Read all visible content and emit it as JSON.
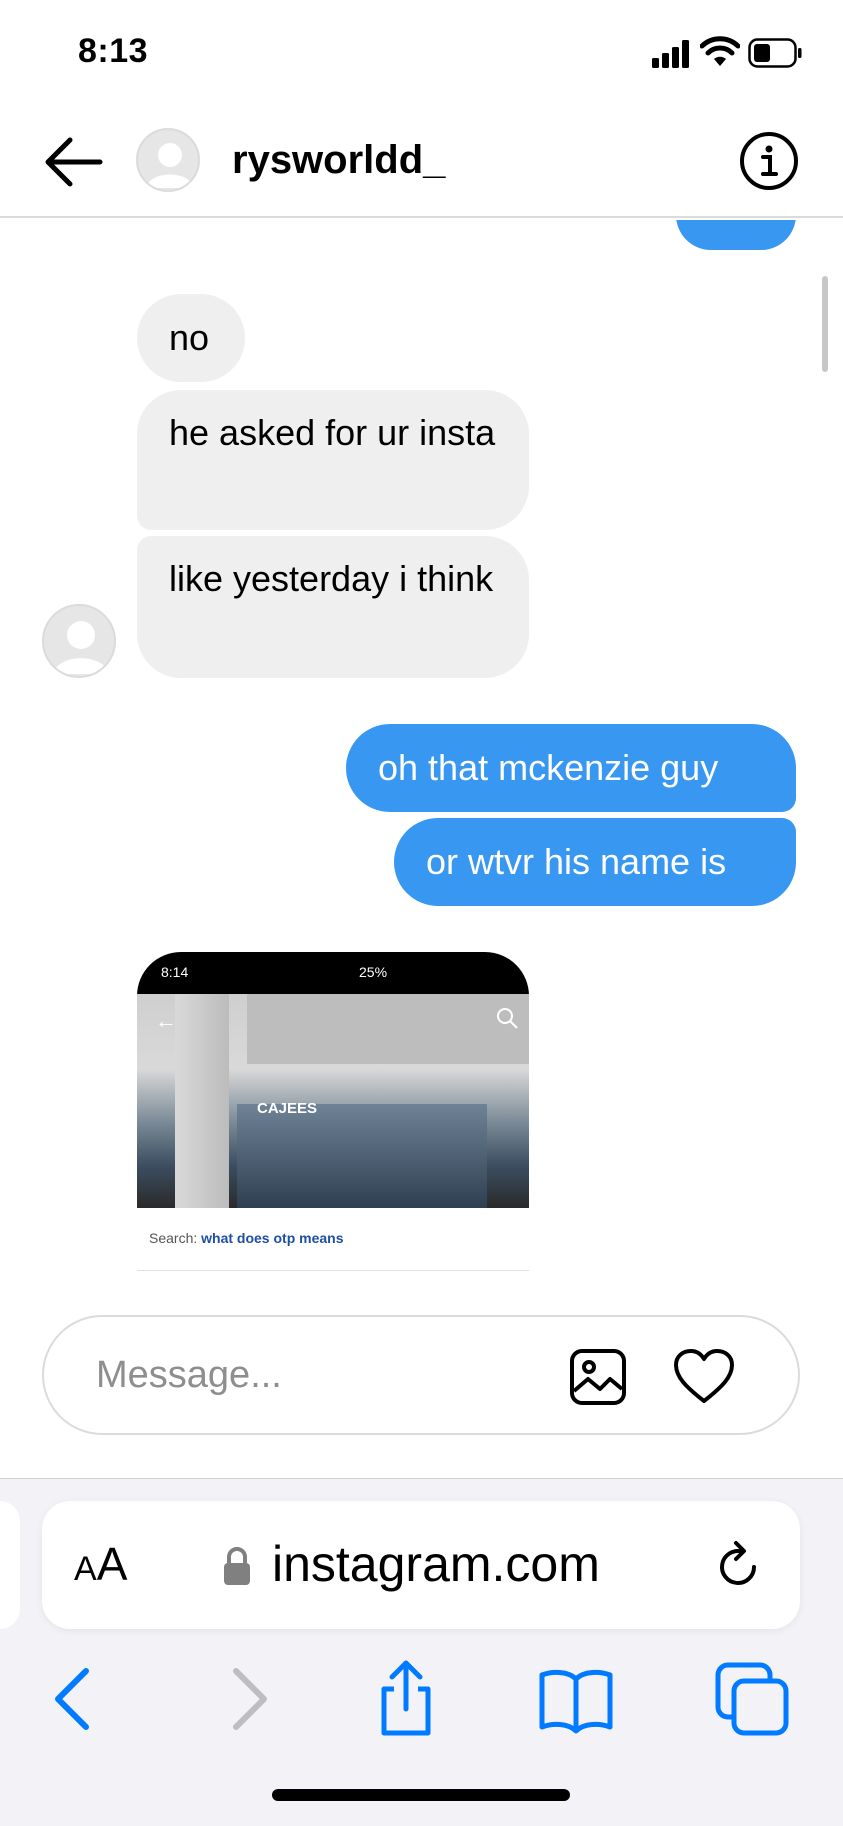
{
  "status_bar": {
    "time": "8:13"
  },
  "header": {
    "username": "rysworldd_"
  },
  "messages": {
    "incoming": [
      "no",
      "he asked for ur insta",
      "like yesterday i think"
    ],
    "outgoing": [
      "oh that mckenzie guy",
      "or wtvr his name is"
    ]
  },
  "shared_media": {
    "status_time": "8:14",
    "status_right": "25%",
    "store_sign": "CAJEES",
    "search_label": "Search:",
    "search_query": "what does otp means"
  },
  "composer": {
    "placeholder": "Message..."
  },
  "browser": {
    "aa_small": "A",
    "aa_large": "A",
    "url": "instagram.com"
  },
  "colors": {
    "outgoing_bubble": "#3897f0",
    "incoming_bubble": "#efefef",
    "ios_blue": "#007aff"
  },
  "icons": [
    "back-arrow-icon",
    "info-icon",
    "gallery-icon",
    "heart-icon",
    "lock-icon",
    "reload-icon",
    "chevron-left-icon",
    "chevron-right-icon",
    "share-icon",
    "bookmarks-icon",
    "tabs-icon"
  ]
}
